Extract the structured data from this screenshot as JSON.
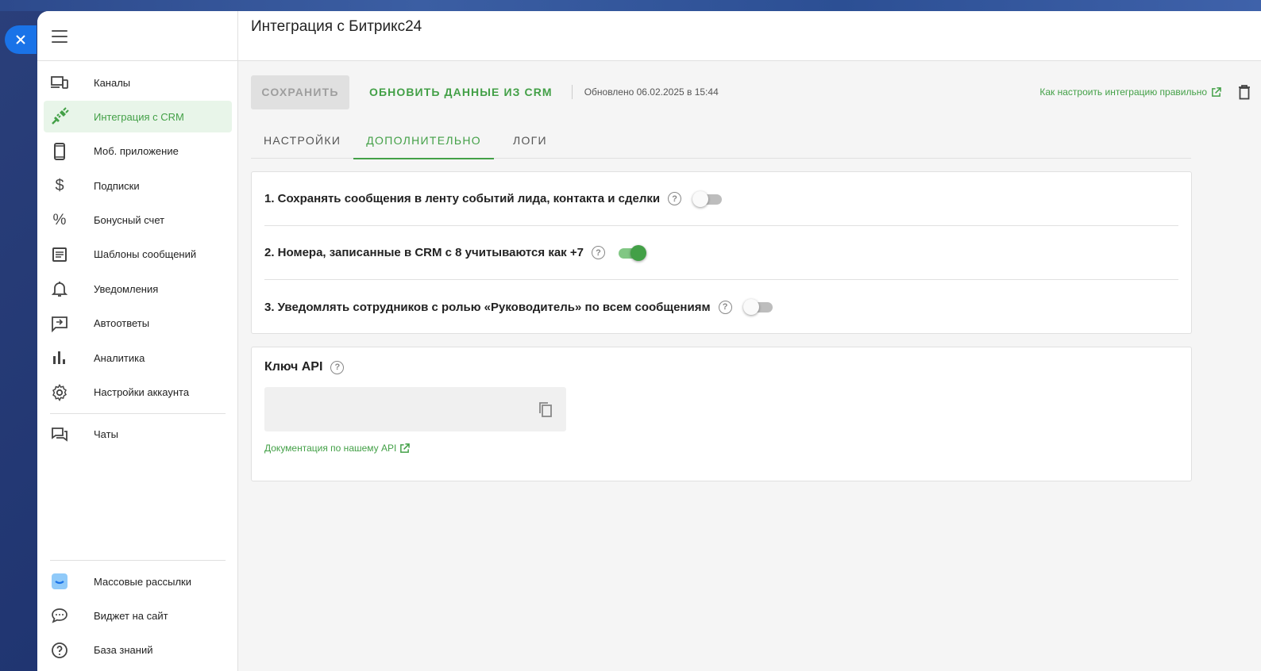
{
  "header": {
    "title": "Интеграция с Битрикс24"
  },
  "sidebar": {
    "items": [
      {
        "label": "Каналы",
        "icon": "devices-icon",
        "active": false
      },
      {
        "label": "Интеграция с CRM",
        "icon": "plug-icon",
        "active": true
      },
      {
        "label": "Моб. приложение",
        "icon": "smartphone-icon",
        "active": false
      },
      {
        "label": "Подписки",
        "icon": "dollar-icon",
        "active": false
      },
      {
        "label": "Бонусный счет",
        "icon": "percent-icon",
        "active": false
      },
      {
        "label": "Шаблоны сообщений",
        "icon": "document-icon",
        "active": false
      },
      {
        "label": "Уведомления",
        "icon": "bell-icon",
        "active": false
      },
      {
        "label": "Автоответы",
        "icon": "reply-icon",
        "active": false
      },
      {
        "label": "Аналитика",
        "icon": "bar-chart-icon",
        "active": false
      },
      {
        "label": "Настройки аккаунта",
        "icon": "gear-icon",
        "active": false
      },
      {
        "label": "Чаты",
        "icon": "chats-icon",
        "active": false
      }
    ],
    "bottom": [
      {
        "label": "Массовые рассылки",
        "icon": "mailing-icon"
      },
      {
        "label": "Виджет на сайт",
        "icon": "chat-bubble-icon"
      },
      {
        "label": "База знаний",
        "icon": "help-icon"
      }
    ]
  },
  "toolbar": {
    "save_label": "СОХРАНИТЬ",
    "update_label": "ОБНОВИТЬ ДАННЫЕ ИЗ CRM",
    "updated_text": "Обновлено 06.02.2025 в 15:44",
    "help_link": "Как настроить интеграцию правильно"
  },
  "tabs": [
    {
      "label": "НАСТРОЙКИ",
      "active": false
    },
    {
      "label": "ДОПОЛНИТЕЛЬНО",
      "active": true
    },
    {
      "label": "ЛОГИ",
      "active": false
    }
  ],
  "settings": [
    {
      "label": "1. Сохранять сообщения в ленту событий лида, контакта и сделки",
      "enabled": false
    },
    {
      "label": "2. Номера, записанные в CRM с 8 учитываются как +7",
      "enabled": true
    },
    {
      "label": "3. Уведомлять сотрудников с ролью «Руководитель» по всем сообщениям",
      "enabled": false
    }
  ],
  "api": {
    "title": "Ключ API",
    "key_value": "",
    "doc_link": "Документация по нашему API"
  },
  "colors": {
    "accent": "#43a047",
    "accent_bg": "#e8f5e9",
    "fab": "#1a73e8"
  }
}
